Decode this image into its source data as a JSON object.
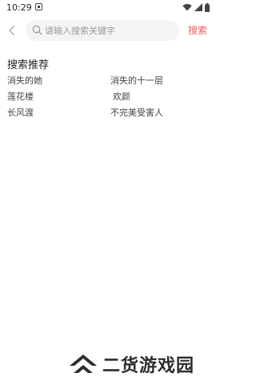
{
  "status_bar": {
    "time": "10:29",
    "notification_icon": "notification-icon",
    "icons": [
      "wifi-icon",
      "signal-icon",
      "battery-icon"
    ]
  },
  "search": {
    "back_icon": "back-icon",
    "search_icon": "search-icon",
    "placeholder": "请输入搜索关键字",
    "value": "",
    "button_label": "搜索",
    "accent_color": "#ee5b5b"
  },
  "recommend": {
    "title": "搜索推荐",
    "items": [
      {
        "label": "消失的她"
      },
      {
        "label": "消失的十一层"
      },
      {
        "label": "莲花楼"
      },
      {
        "label": "欢颜"
      },
      {
        "label": "长风渡"
      },
      {
        "label": "不完美受害人"
      }
    ]
  },
  "watermark": {
    "text": "二货游戏园",
    "logo": "chevron-logo-icon"
  }
}
